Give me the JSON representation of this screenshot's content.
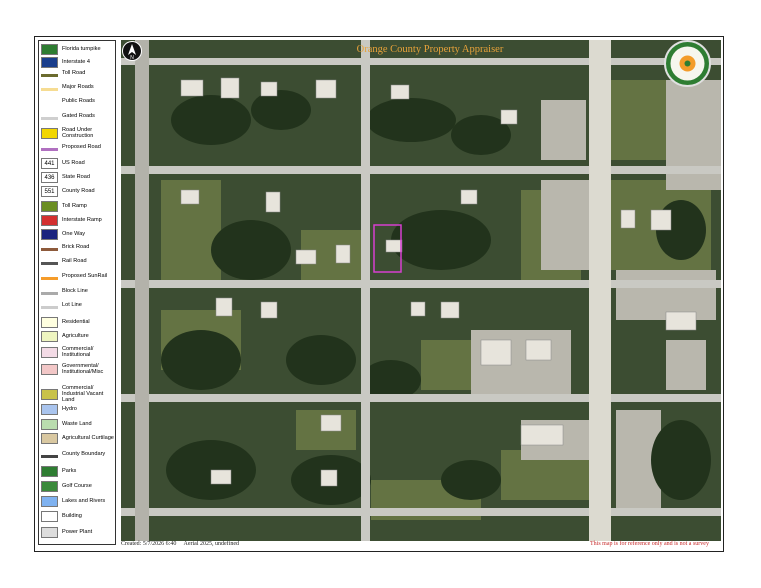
{
  "map_title": "Orange County Property Appraiser",
  "footer": {
    "created": "Created: 5/7/2026 6:40",
    "aerial": "Aerial 2025, undefined",
    "disclaimer": "This map is for reference only and is not a survey"
  },
  "legend": [
    {
      "label": "Florida turnpike",
      "icon": "turnpike-shield-icon",
      "color": "#2e7d32"
    },
    {
      "label": "Interstate 4",
      "icon": "interstate-shield-icon",
      "color": "#1a3e8c"
    },
    {
      "label": "Toll Road",
      "icon": "toll-road-line",
      "color": "#6b6b2e"
    },
    {
      "label": "Major Roads",
      "icon": "major-road-line",
      "color": "#f6dc92"
    },
    {
      "label": "Public Roads",
      "icon": "public-road-line",
      "color": "#ffffff"
    },
    {
      "label": "Gated Roads",
      "icon": "gated-road-line",
      "color": "#cfcfcf"
    },
    {
      "label": "Road Under Construction",
      "icon": "construction-sign-icon",
      "color": "#f2d600"
    },
    {
      "label": "Proposed Road",
      "icon": "proposed-road-line",
      "color": "#b070c0"
    },
    {
      "label": "US Road",
      "icon": "us-road-shield-icon",
      "color": "#ffffff",
      "mark": "441"
    },
    {
      "label": "State Road",
      "icon": "state-road-shield-icon",
      "color": "#ffffff",
      "mark": "436"
    },
    {
      "label": "County Road",
      "icon": "county-road-shield-icon",
      "color": "#ffffff",
      "mark": "551"
    },
    {
      "label": "Toll Ramp",
      "icon": "toll-ramp-arrow-icon",
      "color": "#6b8e23"
    },
    {
      "label": "Interstate Ramp",
      "icon": "interstate-ramp-arrow-icon",
      "color": "#d32f2f"
    },
    {
      "label": "One Way",
      "icon": "one-way-arrow-icon",
      "color": "#1a237e"
    },
    {
      "label": "Brick Road",
      "icon": "brick-road-line",
      "color": "#8d5a3b"
    },
    {
      "label": "Rail Road",
      "icon": "rail-road-line",
      "color": "#555555"
    },
    {
      "label": "Proposed SunRail",
      "icon": "sunrail-line",
      "color": "#f59c2a"
    },
    {
      "label": "Block Line",
      "icon": "block-line",
      "color": "#aaaaaa"
    },
    {
      "label": "Lot Line",
      "icon": "lot-line",
      "color": "#cccccc"
    },
    {
      "label": "Residential",
      "icon": "residential-swatch",
      "color": "#ffffe0"
    },
    {
      "label": "Agriculture",
      "icon": "agriculture-swatch",
      "color": "#eef5c0"
    },
    {
      "label": "Commercial/ Institutional",
      "icon": "commercial-swatch",
      "color": "#f3dbe6"
    },
    {
      "label": "Governmental/ Institutional/Misc",
      "icon": "governmental-swatch",
      "color": "#f2c7c7"
    },
    {
      "label": "Commercial/ Industrial Vacant Land",
      "icon": "vacant-land-swatch",
      "color": "#c8c24a"
    },
    {
      "label": "Hydro",
      "icon": "hydro-swatch",
      "color": "#a9c4ee"
    },
    {
      "label": "Waste Land",
      "icon": "waste-land-swatch",
      "color": "#b9dcae"
    },
    {
      "label": "Agricultural Curtilage",
      "icon": "curtilage-swatch",
      "color": "#d9c8a1"
    },
    {
      "label": "County Boundary",
      "icon": "county-boundary-line",
      "color": "#444444"
    },
    {
      "label": "Parks",
      "icon": "tree-icon",
      "color": "#2e7d32"
    },
    {
      "label": "Golf Course",
      "icon": "golf-course-icon",
      "color": "#3b8a3b"
    },
    {
      "label": "Lakes and Rivers",
      "icon": "water-icon",
      "color": "#7fb2f0"
    },
    {
      "label": "Building",
      "icon": "building-swatch",
      "color": "#ffffff"
    },
    {
      "label": "Power Plant",
      "icon": "power-plant-icon",
      "color": "#dddddd"
    }
  ],
  "colors": {
    "road": "#c9c9c3",
    "major_road": "#e3e1d8",
    "tree_canopy": "#25361f",
    "lawn": "#6d7c47",
    "selected_parcel": "#d63fd0",
    "title": "#e7a23a"
  }
}
